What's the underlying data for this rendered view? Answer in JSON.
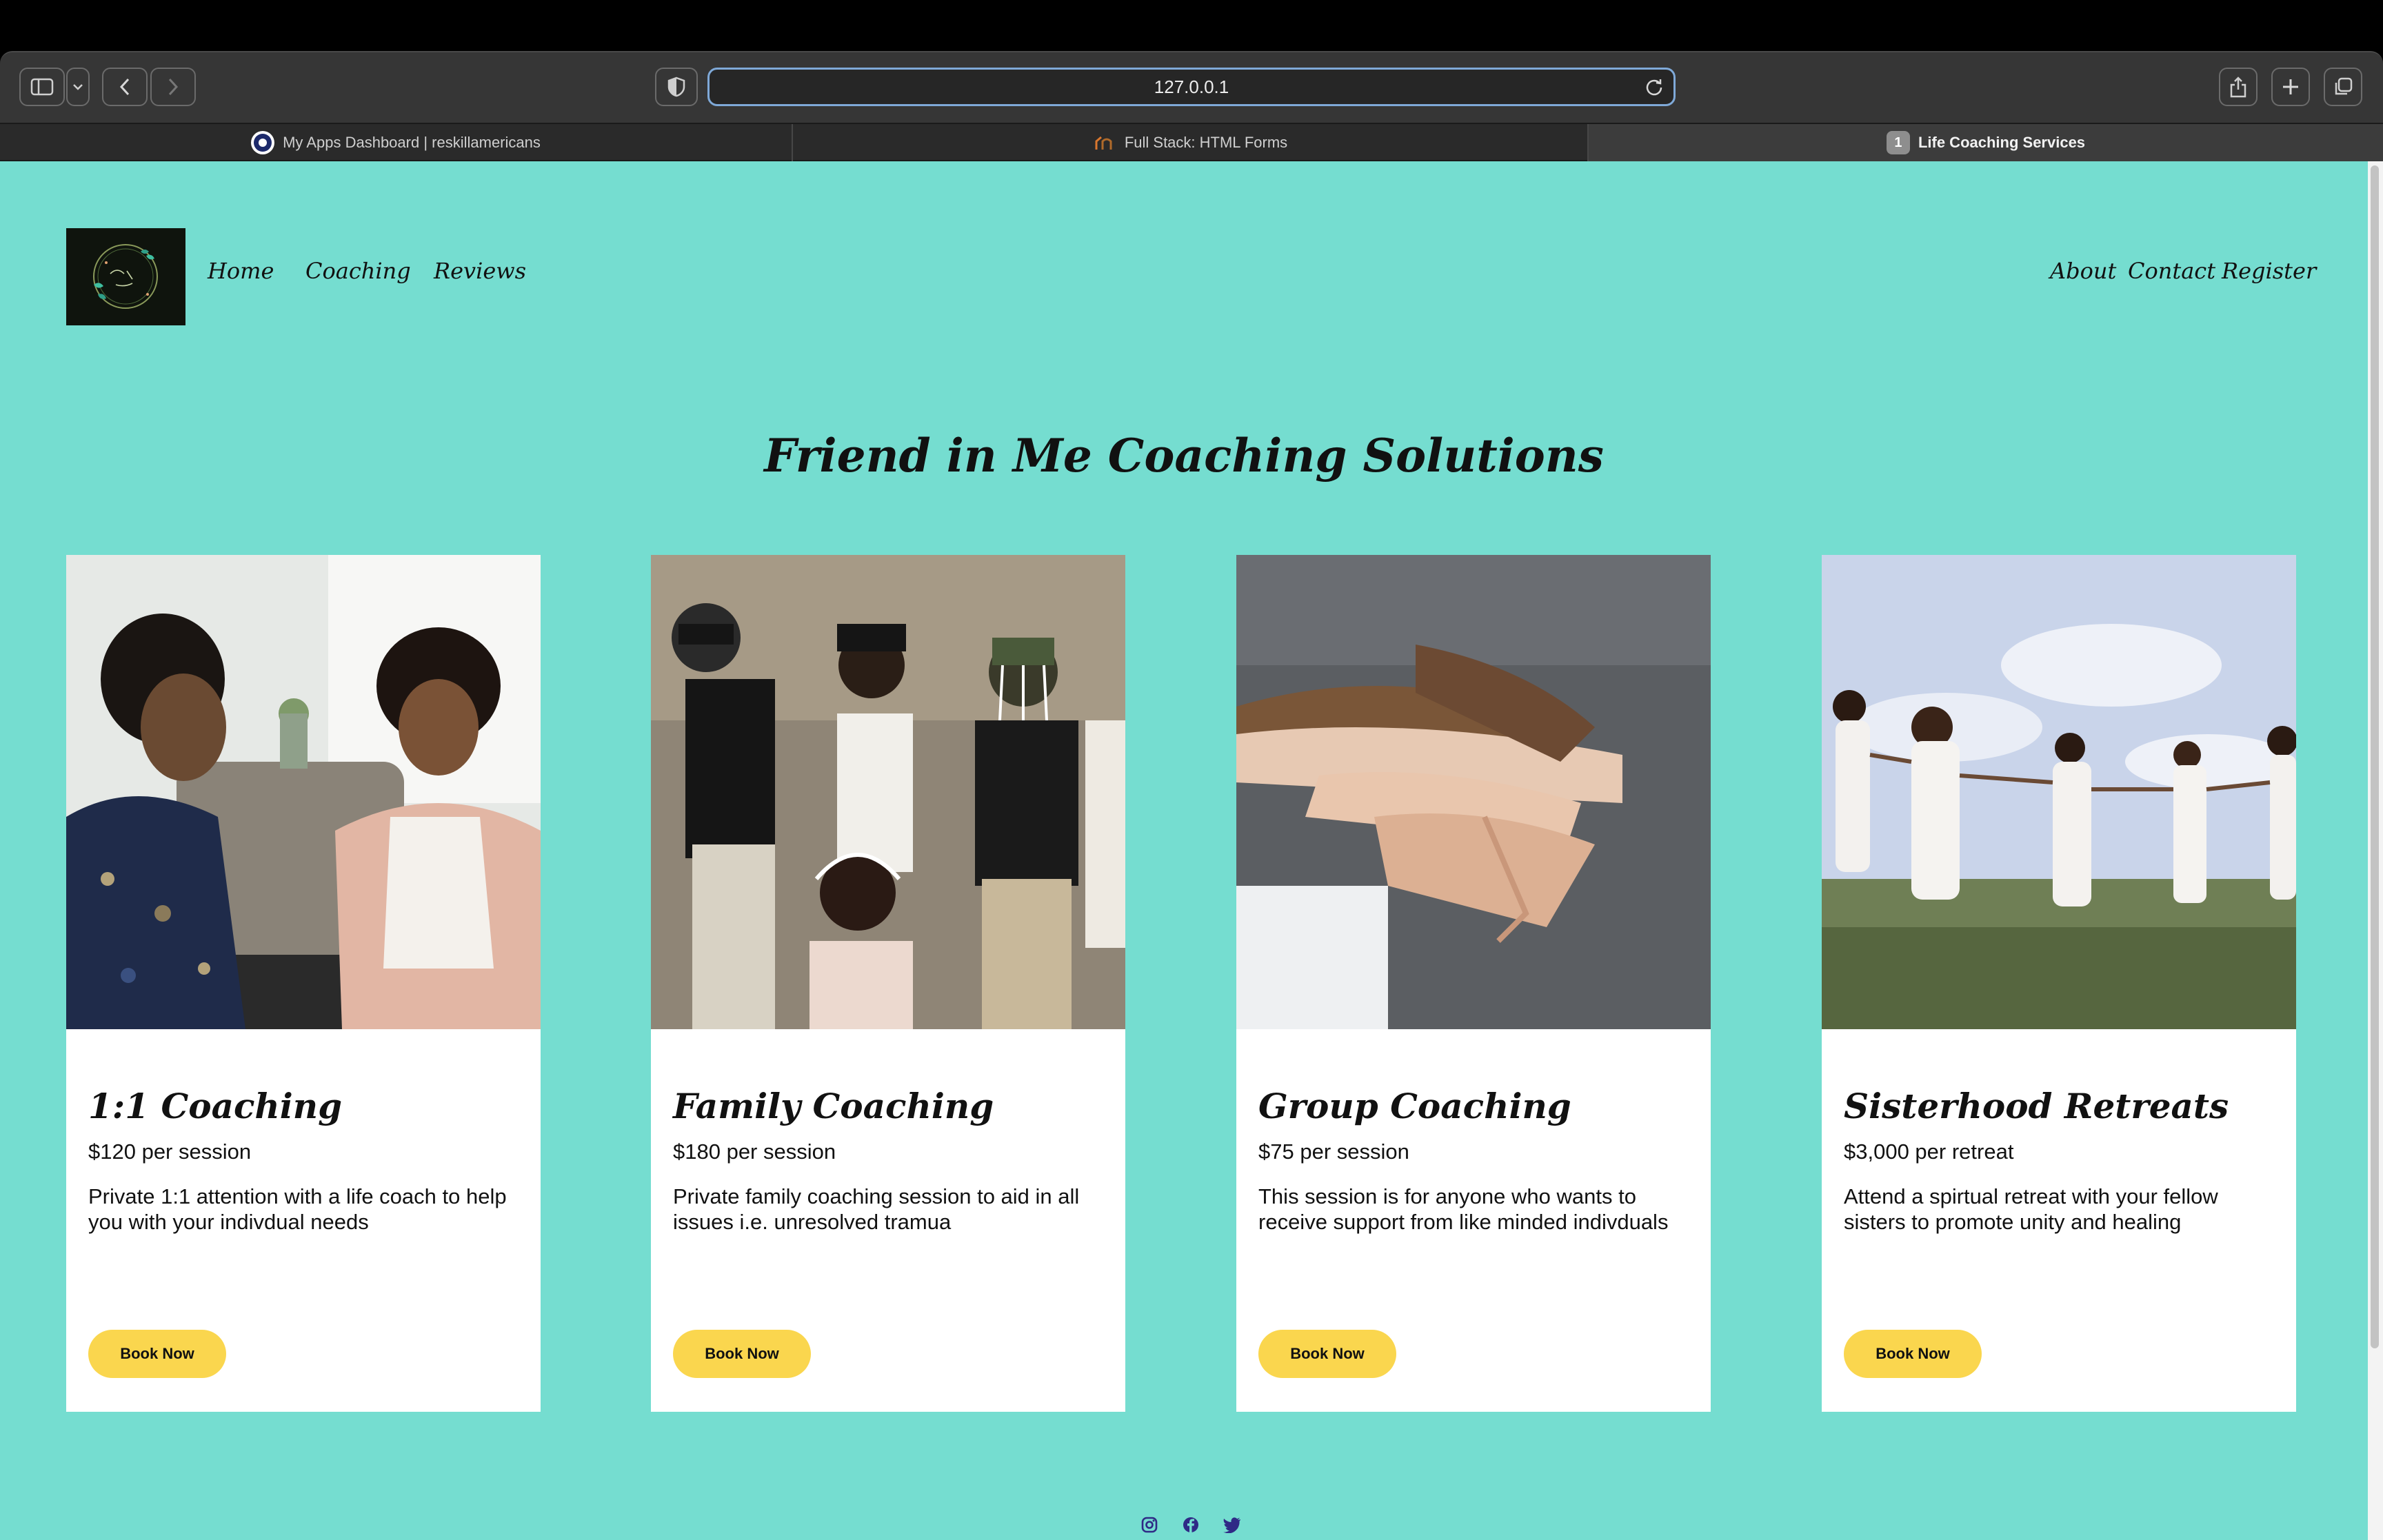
{
  "browser": {
    "url": "127.0.0.1",
    "tabs": [
      {
        "label": "My Apps Dashboard | reskillamericans",
        "active": false
      },
      {
        "label": "Full Stack: HTML Forms",
        "active": false
      },
      {
        "label": "Life Coaching Services",
        "active": true,
        "badge": "1"
      }
    ]
  },
  "nav": {
    "left": [
      "Home",
      "Coaching",
      "Reviews"
    ],
    "right": [
      "About",
      "Contact",
      "Register"
    ]
  },
  "hero": {
    "title": "Friend in Me Coaching Solutions"
  },
  "cards": [
    {
      "title": "1:1 Coaching",
      "price": "$120 per session",
      "description": "Private 1:1 attention with a life coach to help you with your indivdual needs",
      "button": "Book Now"
    },
    {
      "title": "Family Coaching",
      "price": "$180 per session",
      "description": "Private family coaching session to aid in all issues i.e. unresolved tramua",
      "button": "Book Now"
    },
    {
      "title": "Group Coaching",
      "price": "$75 per session",
      "description": "This session is for anyone who wants to receive support from like minded indivduals",
      "button": "Book Now"
    },
    {
      "title": "Sisterhood Retreats",
      "price": "$3,000 per retreat",
      "description": "Attend a spirtual retreat with your fellow sisters to promote unity and healing",
      "button": "Book Now"
    }
  ],
  "footer": {
    "icons": [
      "instagram-icon",
      "facebook-icon",
      "twitter-icon"
    ]
  },
  "colors": {
    "page_bg": "#75ddd0",
    "button_bg": "#fad64e",
    "card_bg": "#ffffff"
  }
}
